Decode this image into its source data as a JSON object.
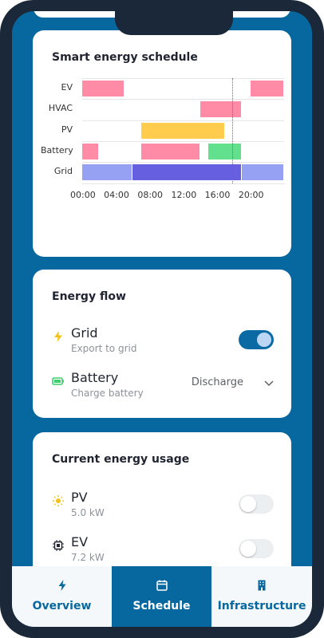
{
  "schedule_card": {
    "title": "Smart energy schedule",
    "chart_data": {
      "type": "gantt",
      "rows": [
        "EV",
        "HVAC",
        "PV",
        "Battery",
        "Grid"
      ],
      "x_ticks": [
        "00:00",
        "04:00",
        "08:00",
        "12:00",
        "16:00",
        "20:00"
      ],
      "x_range_hours": [
        0,
        24
      ],
      "now_hour": 17.8,
      "colors": {
        "pink": "#ff8ba6",
        "yellow": "#ffcc4d",
        "green": "#63e08e",
        "grid_light": "#97a1f4",
        "grid_dark": "#6660e0",
        "now_line": "#d23c5a"
      },
      "bars": [
        {
          "row": "EV",
          "start": 0,
          "end": 5,
          "color": "pink"
        },
        {
          "row": "EV",
          "start": 20,
          "end": 24,
          "color": "pink"
        },
        {
          "row": "HVAC",
          "start": 14,
          "end": 19,
          "color": "pink"
        },
        {
          "row": "PV",
          "start": 7,
          "end": 17,
          "color": "yellow"
        },
        {
          "row": "Battery",
          "start": 0,
          "end": 2,
          "color": "pink"
        },
        {
          "row": "Battery",
          "start": 7,
          "end": 14,
          "color": "pink"
        },
        {
          "row": "Battery",
          "start": 15,
          "end": 19,
          "color": "green"
        },
        {
          "row": "Grid",
          "start": 0,
          "end": 6,
          "color": "grid_light"
        },
        {
          "row": "Grid",
          "start": 6,
          "end": 19,
          "color": "grid_dark"
        },
        {
          "row": "Grid",
          "start": 19,
          "end": 24,
          "color": "grid_light"
        }
      ]
    }
  },
  "energy_flow": {
    "title": "Energy flow",
    "grid": {
      "name": "Grid",
      "sub": "Export to grid",
      "toggle_on": true,
      "icon": "lightning-icon"
    },
    "battery": {
      "name": "Battery",
      "sub": "Charge battery",
      "select_value": "Discharge",
      "icon": "battery-icon"
    }
  },
  "usage": {
    "title": "Current energy usage",
    "pv": {
      "name": "PV",
      "sub": "5.0 kW",
      "toggle_on": false,
      "icon": "sun-icon"
    },
    "ev": {
      "name": "EV",
      "sub": "7.2 kW",
      "toggle_on": false,
      "icon": "chip-icon"
    }
  },
  "nav": {
    "overview": "Overview",
    "schedule": "Schedule",
    "infrastructure": "Infrastructure",
    "active": "Schedule"
  }
}
